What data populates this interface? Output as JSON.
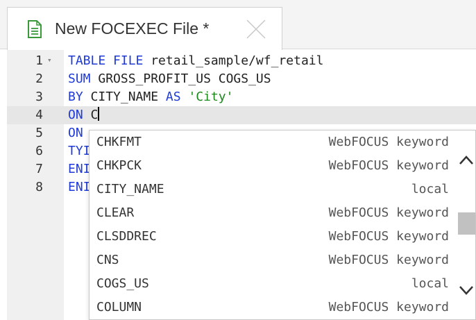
{
  "tab": {
    "title": "New FOCEXEC File *",
    "icon": "document-icon",
    "close_icon": "close-icon"
  },
  "editor": {
    "lines": [
      {
        "num": "1",
        "tokens": [
          {
            "t": "TABLE FILE",
            "c": "kw"
          },
          {
            "t": " retail_sample/wf_retail",
            "c": ""
          }
        ]
      },
      {
        "num": "2",
        "tokens": [
          {
            "t": "SUM",
            "c": "kw"
          },
          {
            "t": " GROSS_PROFIT_US COGS_US",
            "c": ""
          }
        ]
      },
      {
        "num": "3",
        "tokens": [
          {
            "t": "BY",
            "c": "kw"
          },
          {
            "t": " CITY_NAME ",
            "c": ""
          },
          {
            "t": "AS",
            "c": "kw"
          },
          {
            "t": " ",
            "c": ""
          },
          {
            "t": "'City'",
            "c": "str"
          }
        ]
      },
      {
        "num": "4",
        "tokens": [
          {
            "t": "ON",
            "c": "kw"
          },
          {
            "t": " C",
            "c": ""
          }
        ]
      },
      {
        "num": "5",
        "tokens": [
          {
            "t": "ON",
            "c": "kw"
          }
        ]
      },
      {
        "num": "6",
        "tokens": [
          {
            "t": "TYI",
            "c": "kw"
          }
        ]
      },
      {
        "num": "7",
        "tokens": [
          {
            "t": "ENI",
            "c": "kw"
          }
        ]
      },
      {
        "num": "8",
        "tokens": [
          {
            "t": "ENI",
            "c": "kw"
          }
        ]
      }
    ],
    "fold_marker": "▾",
    "active_line": 4
  },
  "autocomplete": {
    "items": [
      {
        "label": "CHKFMT",
        "meta": "WebFOCUS keyword"
      },
      {
        "label": "CHKPCK",
        "meta": "WebFOCUS keyword"
      },
      {
        "label": "CITY_NAME",
        "meta": "local"
      },
      {
        "label": "CLEAR",
        "meta": "WebFOCUS keyword"
      },
      {
        "label": "CLSDDREC",
        "meta": "WebFOCUS keyword"
      },
      {
        "label": "CNS",
        "meta": "WebFOCUS keyword"
      },
      {
        "label": "COGS_US",
        "meta": "local"
      },
      {
        "label": "COLUMN",
        "meta": "WebFOCUS keyword"
      }
    ]
  },
  "colors": {
    "keyword": "#1f3ad6",
    "string": "#1a8a1a",
    "active_line_bg": "#e6e6e6"
  }
}
